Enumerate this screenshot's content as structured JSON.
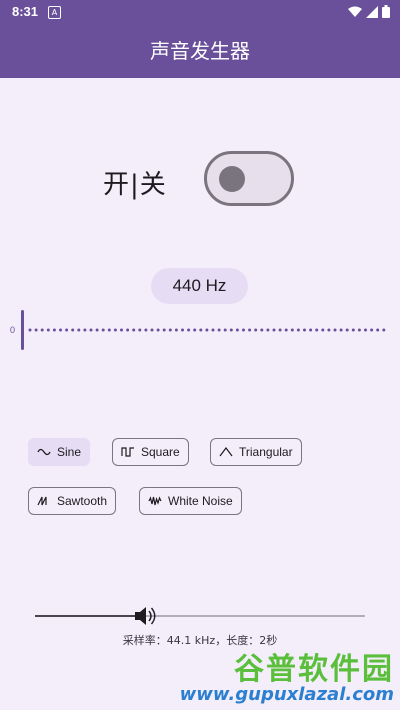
{
  "status_bar": {
    "time": "8:31",
    "notification_letter": "A"
  },
  "app_bar": {
    "title": "声音发生器"
  },
  "power": {
    "label": "开|关",
    "on": false
  },
  "frequency": {
    "label": "440 Hz",
    "slider_min_marker": "0"
  },
  "waveforms": [
    {
      "label": "Sine",
      "icon": "sine-wave-icon",
      "selected": true
    },
    {
      "label": "Square",
      "icon": "square-wave-icon",
      "selected": false
    },
    {
      "label": "Triangular",
      "icon": "triangle-wave-icon",
      "selected": false
    },
    {
      "label": "Sawtooth",
      "icon": "sawtooth-wave-icon",
      "selected": false
    },
    {
      "label": "White Noise",
      "icon": "noise-wave-icon",
      "selected": false
    }
  ],
  "volume": {
    "icon": "speaker-icon",
    "level": 0.33
  },
  "info_text": "采样率：44.1 kHz，长度：2秒",
  "watermark": {
    "title": "谷普软件园",
    "url": "www.gupuxlazal.com"
  },
  "colors": {
    "primary": "#6a509b",
    "background": "#f3eefa",
    "chip": "#e6ddf4",
    "watermark_green": "#5bbf3c",
    "watermark_blue": "#2b7fd1"
  }
}
